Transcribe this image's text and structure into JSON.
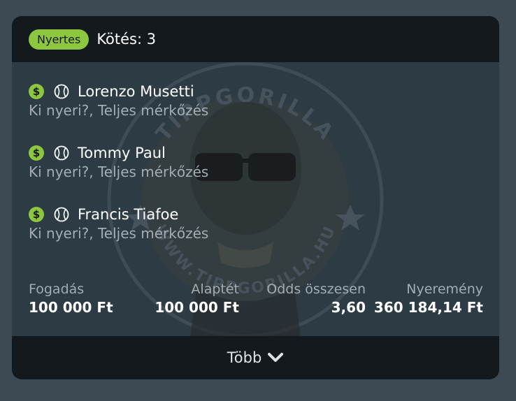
{
  "header": {
    "status_badge": "Nyertes",
    "title": "Kötés: 3"
  },
  "selections": [
    {
      "player": "Lorenzo Musetti",
      "market": "Ki nyeri?, Teljes mérkőzés",
      "icons": [
        "dollar-icon",
        "tennis-ball-icon"
      ]
    },
    {
      "player": "Tommy Paul",
      "market": "Ki nyeri?, Teljes mérkőzés",
      "icons": [
        "dollar-icon",
        "tennis-ball-icon"
      ]
    },
    {
      "player": "Francis Tiafoe",
      "market": "Ki nyeri?, Teljes mérkőzés",
      "icons": [
        "dollar-icon",
        "tennis-ball-icon"
      ]
    }
  ],
  "dollar_symbol": "$",
  "stats": {
    "stake_label": "Fogadás",
    "stake_value": "100 000 Ft",
    "base_label": "Alaptét",
    "base_value": "100 000 Ft",
    "odds_label": "Odds összesen",
    "odds_value": "3,60",
    "win_label": "Nyeremény",
    "win_value": "360 184,14 Ft"
  },
  "footer": {
    "more_label": "Több"
  },
  "watermark": {
    "text_top": "TIPPGORILLA",
    "text_bottom": "WWW.TIPPGORILLA.HU"
  },
  "colors": {
    "page_bg": "#3d4a53",
    "card_bg": "#2d3b44",
    "header_bg": "#14191d",
    "accent": "#8dc63f",
    "muted_text": "#a3adb3"
  }
}
